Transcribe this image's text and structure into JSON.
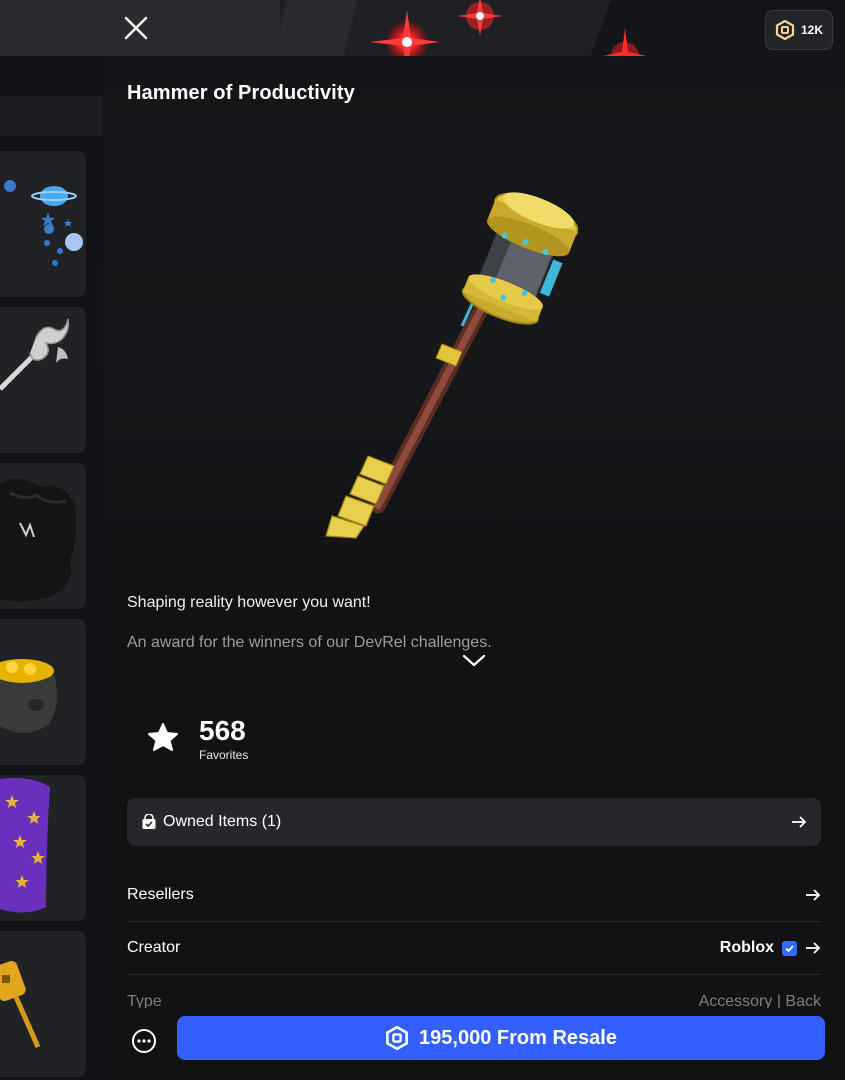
{
  "topbar": {
    "close_icon": "close-icon",
    "robux_balance": "12K",
    "robux_icon": "robux-icon"
  },
  "item": {
    "title": "Hammer of Productivity",
    "description_line1": "Shaping reality however you want!",
    "description_line2": "An award for the winners of our DevRel challenges.",
    "favorites_count": "568",
    "favorites_label": "Favorites"
  },
  "owned": {
    "label": "Owned Items (1)"
  },
  "details": {
    "resellers_label": "Resellers",
    "creator_label": "Creator",
    "creator_name": "Roblox",
    "type_label": "Type",
    "type_value": "Accessory | Back"
  },
  "purchase": {
    "button_label": "195,000 From Resale"
  },
  "colors": {
    "accent": "#335fff",
    "background": "#111214",
    "panel_row": "#26272b"
  }
}
